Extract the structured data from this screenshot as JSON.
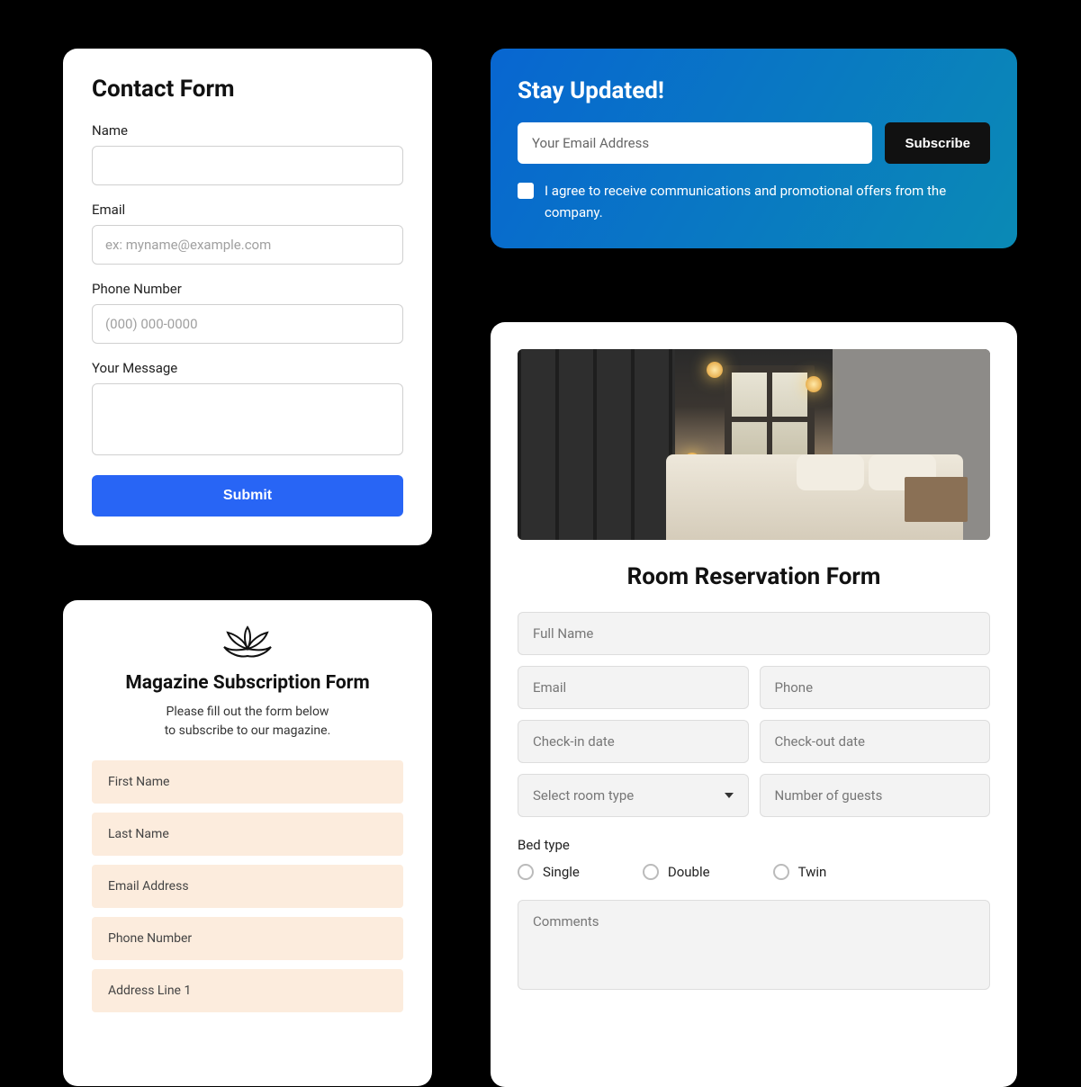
{
  "contact": {
    "title": "Contact Form",
    "name_label": "Name",
    "email_label": "Email",
    "email_placeholder": "ex: myname@example.com",
    "phone_label": "Phone Number",
    "phone_placeholder": "(000) 000-0000",
    "message_label": "Your Message",
    "submit": "Submit"
  },
  "newsletter": {
    "title": "Stay Updated!",
    "email_placeholder": "Your Email Address",
    "subscribe": "Subscribe",
    "consent": "I agree to receive communications and promotional offers from the company."
  },
  "magazine": {
    "title": "Magazine Subscription Form",
    "subtitle_line1": "Please fill out the form below",
    "subtitle_line2": "to subscribe to our magazine.",
    "fields": {
      "first_name": "First Name",
      "last_name": "Last Name",
      "email": "Email Address",
      "phone": "Phone Number",
      "address1": "Address Line 1"
    }
  },
  "room": {
    "title": "Room Reservation Form",
    "full_name": "Full Name",
    "email": "Email",
    "phone": "Phone",
    "checkin": "Check-in date",
    "checkout": "Check-out date",
    "room_type": "Select room type",
    "guests": "Number of guests",
    "bed_type_label": "Bed type",
    "bed_single": "Single",
    "bed_double": "Double",
    "bed_twin": "Twin",
    "comments": "Comments"
  }
}
